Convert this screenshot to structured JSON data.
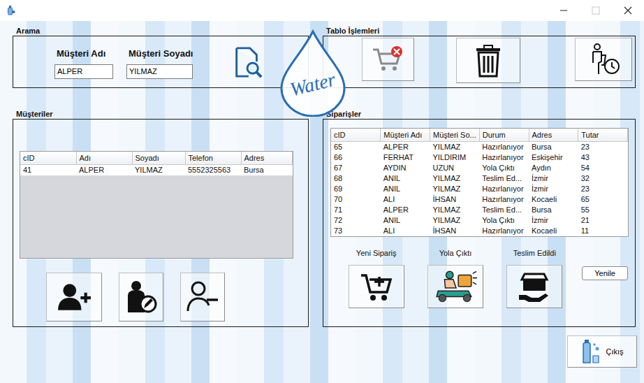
{
  "window_controls": [
    {
      "kind": "minimize",
      "disabled": false
    },
    {
      "kind": "maximize",
      "disabled": true
    },
    {
      "kind": "close",
      "disabled": false
    }
  ],
  "logo": {
    "text": "Water"
  },
  "search": {
    "title": "Arama",
    "fields": [
      {
        "label": "Müşteri Adı",
        "value": "ALPER"
      },
      {
        "label": "Müşteri Soyadı",
        "value": "YILMAZ"
      }
    ]
  },
  "table_actions": {
    "title": "Tablo İşlemleri",
    "buttons": [
      {
        "kind": "cart-remove"
      },
      {
        "kind": "trash"
      },
      {
        "kind": "clear-history"
      }
    ]
  },
  "customers": {
    "title": "Müşteriler",
    "columns": [
      "cID",
      "Adı",
      "Soyadı",
      "Telefon",
      "Adres"
    ],
    "rows": [
      {
        "cells": [
          "41",
          "ALPER",
          "YILMAZ",
          "5552325563",
          "Bursa"
        ],
        "selected": false
      }
    ],
    "buttons": [
      {
        "kind": "add-user"
      },
      {
        "kind": "edit-user"
      },
      {
        "kind": "remove-user"
      }
    ]
  },
  "orders": {
    "title": "Siparişler",
    "columns": [
      "cID",
      "Müşteri Adı",
      "Müşteri So...",
      "Durum",
      "Adres",
      "Tutar"
    ],
    "rows": [
      {
        "cells": [
          "65",
          "ALPER",
          "YILMAZ",
          "Hazırlanıyor",
          "Bursa",
          "23"
        ],
        "selected": false
      },
      {
        "cells": [
          "66",
          "FERHAT",
          "YILDIRIM",
          "Hazırlanıyor",
          "Eskişehir",
          "43"
        ],
        "selected": false
      },
      {
        "cells": [
          "67",
          "AYDIN",
          "UZUN",
          "Yola Çıktı",
          "Aydın",
          "54"
        ],
        "selected": false
      },
      {
        "cells": [
          "68",
          "ANIL",
          "YILMAZ",
          "Teslim Ed...",
          "İzmir",
          "32"
        ],
        "selected": false
      },
      {
        "cells": [
          "69",
          "ANIL",
          "YILMAZ",
          "Hazırlanıyor",
          "İzmir",
          "23"
        ],
        "selected": false
      },
      {
        "cells": [
          "70",
          "ALI",
          "İHSAN",
          "Hazırlanıyor",
          "Kocaeli",
          "65"
        ],
        "selected": false
      },
      {
        "cells": [
          "71",
          "ALPER",
          "YILMAZ",
          "Teslim Ed...",
          "Bursa",
          "55"
        ],
        "selected": false
      },
      {
        "cells": [
          "72",
          "ANIL",
          "YILMAZ",
          "Yola Çıktı",
          "İzmir",
          "21"
        ],
        "selected": false
      },
      {
        "cells": [
          "73",
          "ALI",
          "İHSAN",
          "Hazırlanıyor",
          "Kocaeli",
          "11"
        ],
        "selected": false
      }
    ],
    "actions": [
      {
        "label": "Yeni Sipariş",
        "kind": "new-order"
      },
      {
        "label": "Yola Çıktı",
        "kind": "on-the-way"
      },
      {
        "label": "Teslim Edildi",
        "kind": "delivered"
      }
    ],
    "refresh": "Yenile"
  },
  "exit": {
    "label": "Çıkış"
  }
}
